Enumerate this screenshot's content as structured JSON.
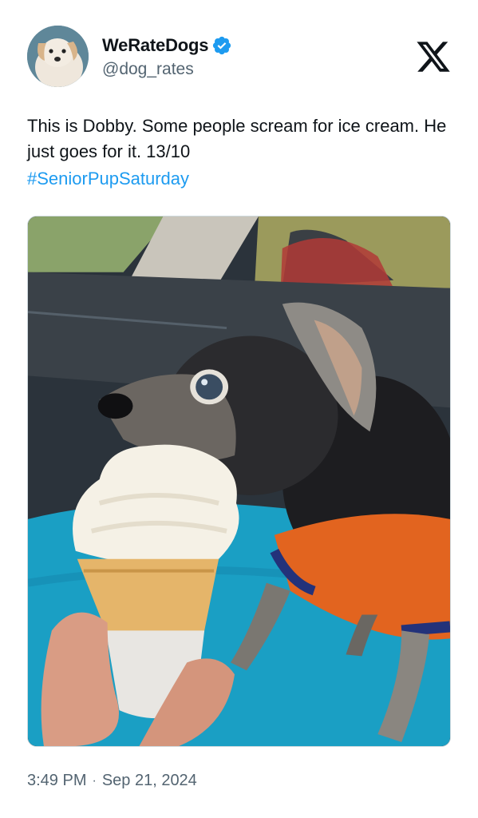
{
  "author": {
    "display_name": "WeRateDogs",
    "handle": "@dog_rates",
    "verified_icon": "verified-badge-icon",
    "avatar_icon": "dog-avatar"
  },
  "platform_logo": "x-logo-icon",
  "tweet": {
    "text": "This is Dobby. Some people scream for ice cream. He just goes for it. 13/10",
    "hashtag": "#SeniorPupSaturday"
  },
  "media": {
    "type": "photo"
  },
  "footer": {
    "time": "3:49 PM",
    "separator": "·",
    "date": "Sep 21, 2024"
  },
  "colors": {
    "text": "#0f1419",
    "secondary": "#536471",
    "link": "#1d9bf0",
    "verified": "#1d9bf0"
  }
}
